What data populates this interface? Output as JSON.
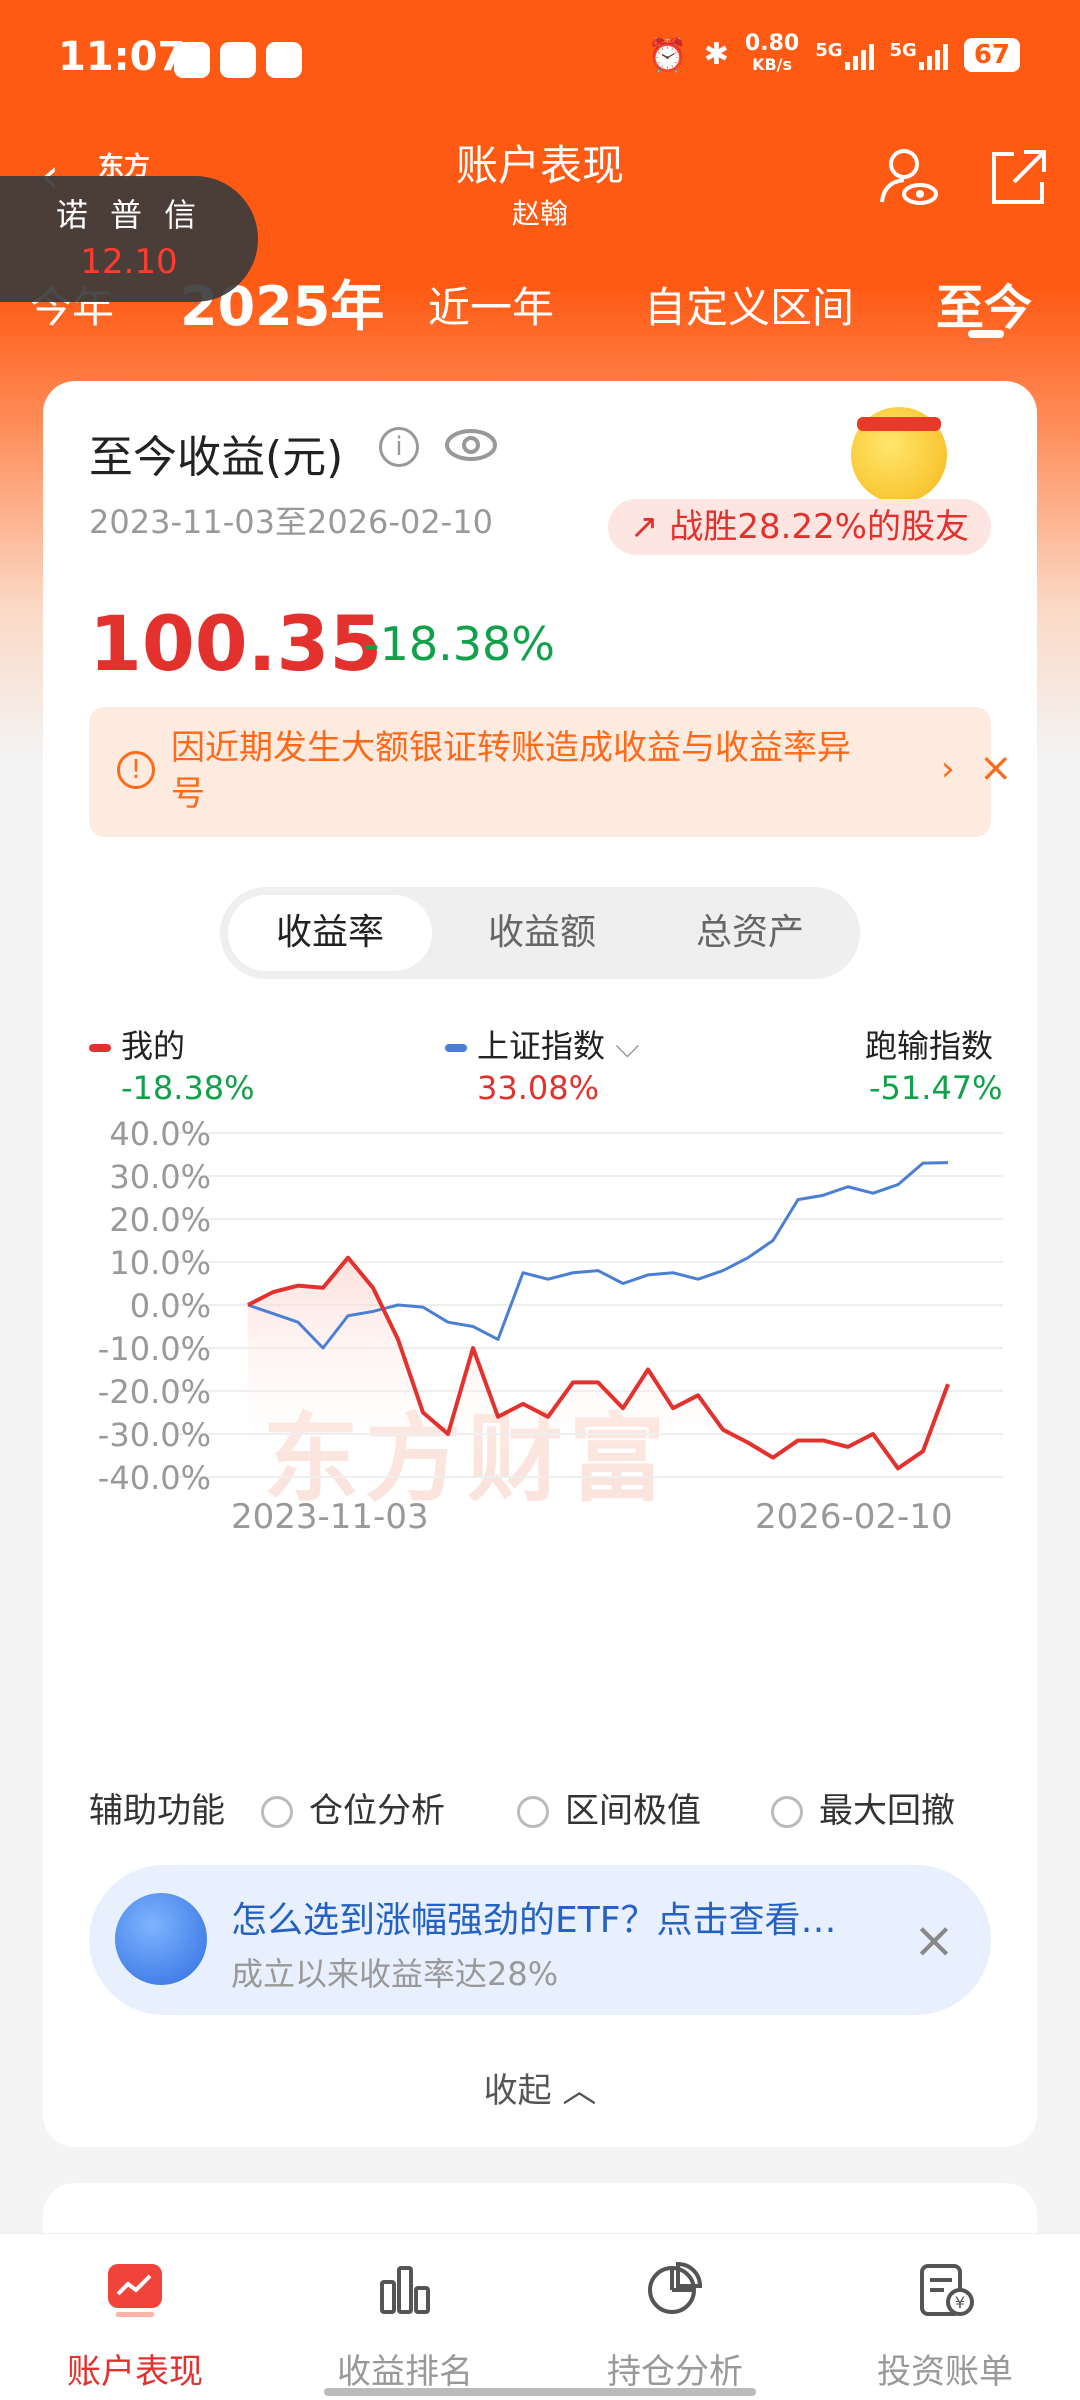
{
  "status": {
    "time": "11:07",
    "net_speed_top": "0.80",
    "net_speed_bottom": "KB/s",
    "net1": "5G",
    "net2": "5G",
    "battery": "67"
  },
  "header": {
    "title": "账户表现",
    "subtitle": "赵翰",
    "logo_text": "东方"
  },
  "float_stock": {
    "name": "诺 普 信",
    "price": "12.10"
  },
  "period_tabs": [
    {
      "label": "今年"
    },
    {
      "label": "2025年"
    },
    {
      "label": "近一年"
    },
    {
      "label": "自定义区间"
    },
    {
      "label": "至今"
    }
  ],
  "card": {
    "title": "至今收益(元)",
    "date_range": "2023-11-03至2026-02-10",
    "beat_text": "战胜28.22%的股友",
    "profit": "100.35",
    "profit_rate": "-18.38%",
    "notice": "因近期发生大额银证转账造成收益与收益率异号"
  },
  "segment": {
    "tabs": [
      "收益率",
      "收益额",
      "总资产"
    ],
    "active": 0
  },
  "legend": {
    "mine_label": "我的",
    "mine_value": "-18.38%",
    "index_label": "上证指数",
    "index_value": "33.08%",
    "diff_label": "跑输指数",
    "diff_value": "-51.47%"
  },
  "colors": {
    "accent": "#ff5a14",
    "mine": "#e3312d",
    "index": "#4a7fd4",
    "up": "#e3312d",
    "down": "#12a14b"
  },
  "chart_data": {
    "type": "line",
    "x_start_label": "2023-11-03",
    "x_end_label": "2026-02-10",
    "y_ticks": [
      "40.0%",
      "30.0%",
      "20.0%",
      "10.0%",
      "0.0%",
      "-10.0%",
      "-20.0%",
      "-30.0%",
      "-40.0%"
    ],
    "ylim": [
      -40,
      40
    ],
    "watermark": "东方财富",
    "series": [
      {
        "name": "我的",
        "values": [
          0,
          3,
          4.5,
          4,
          11,
          4,
          -8,
          -25,
          -30,
          -10,
          -26,
          -23,
          -26,
          -18,
          -18,
          -24,
          -15,
          -24,
          -21,
          -29,
          -32,
          -35.5,
          -31.5,
          -31.5,
          -33,
          -30,
          -38,
          -34,
          -18.4
        ]
      },
      {
        "name": "上证指数",
        "values": [
          0,
          -2,
          -4,
          -10,
          -2.5,
          -1.5,
          0,
          -0.5,
          -4,
          -5,
          -8,
          7.5,
          6,
          7.5,
          8,
          5,
          7,
          7.5,
          6,
          8,
          11,
          15,
          24.5,
          25.5,
          27.5,
          26,
          28,
          33,
          33.1
        ]
      }
    ]
  },
  "aux": {
    "label": "辅助功能",
    "options": [
      "仓位分析",
      "区间极值",
      "最大回撤"
    ]
  },
  "ad": {
    "title": "怎么选到涨幅强劲的ETF？点击查看…",
    "subtitle": "成立以来收益率达28%"
  },
  "collapse_label": "收起",
  "bottom_nav": [
    {
      "label": "账户表现",
      "icon": "chart-trend-icon"
    },
    {
      "label": "收益排名",
      "icon": "bar-chart-icon"
    },
    {
      "label": "持仓分析",
      "icon": "pie-chart-icon"
    },
    {
      "label": "投资账单",
      "icon": "bill-icon"
    }
  ]
}
